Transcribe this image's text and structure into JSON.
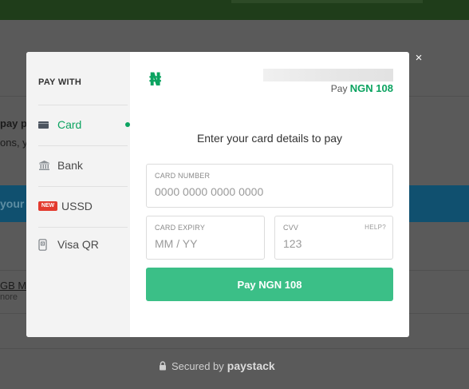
{
  "background": {
    "snippets": [
      "pay p",
      "ons, y",
      "your l",
      "GB M",
      "nore"
    ]
  },
  "close_label": "×",
  "sidebar": {
    "title": "PAY WITH",
    "methods": [
      {
        "label": "Card",
        "icon": "credit-card-icon",
        "active": true
      },
      {
        "label": "Bank",
        "icon": "bank-icon"
      },
      {
        "label": "USSD",
        "icon": "new-badge",
        "badge": "NEW"
      },
      {
        "label": "Visa QR",
        "icon": "qr-phone-icon"
      }
    ]
  },
  "header": {
    "currency_symbol": "₦",
    "pay_prefix": "Pay",
    "pay_amount": "NGN 108"
  },
  "form": {
    "heading": "Enter your card details to pay",
    "card_number": {
      "label": "CARD NUMBER",
      "placeholder": "0000 0000 0000 0000"
    },
    "card_expiry": {
      "label": "CARD EXPIRY",
      "placeholder": "MM / YY"
    },
    "cvv": {
      "label": "CVV",
      "placeholder": "123",
      "help": "HELP?"
    },
    "submit_label": "Pay NGN 108"
  },
  "footer": {
    "secured_text": "Secured by",
    "brand": "paystack"
  },
  "colors": {
    "accent": "#0ba360",
    "button": "#3bbf87",
    "badge": "#e33b2f"
  }
}
